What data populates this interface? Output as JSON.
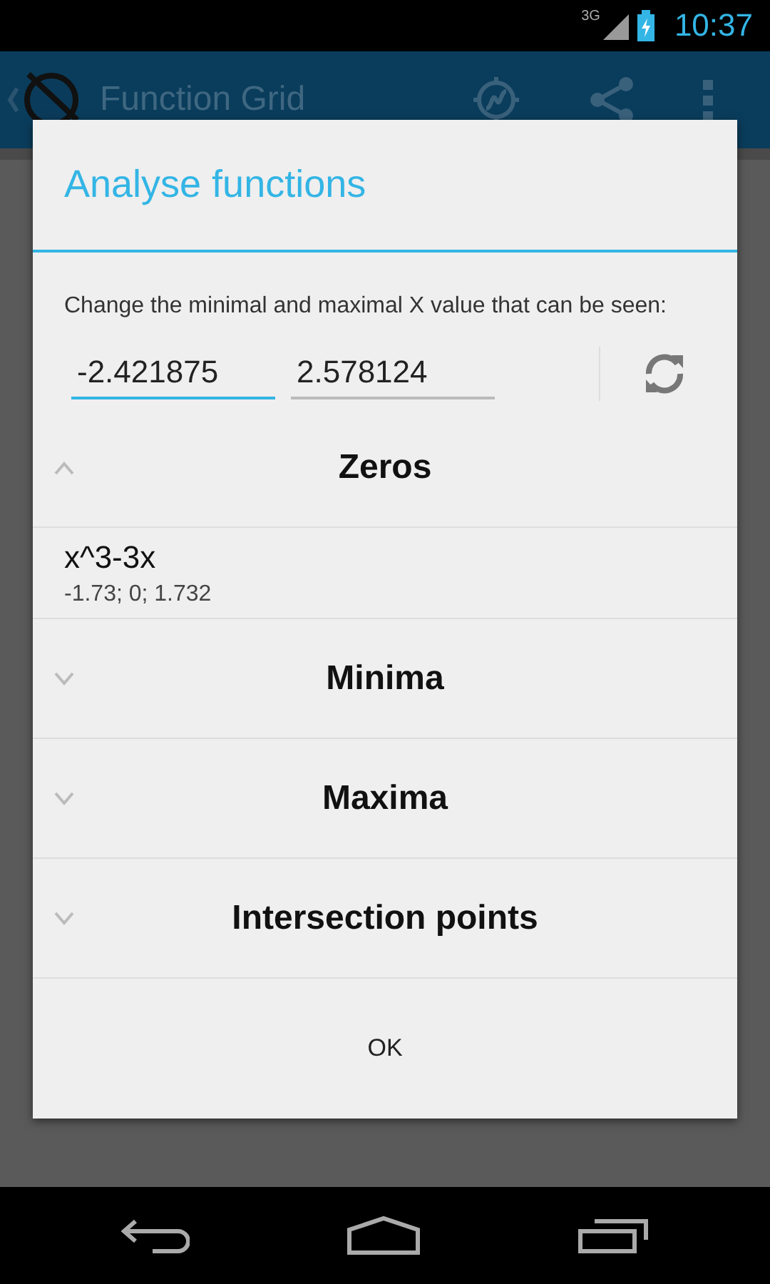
{
  "status_bar": {
    "network": "3G",
    "time": "10:37"
  },
  "app_bar": {
    "title": "Function Grid"
  },
  "dialog": {
    "title": "Analyse functions",
    "description": "Change the minimal and maximal X value that can be seen:",
    "fields": [
      {
        "value": "-2.421875",
        "focused": true
      },
      {
        "value": "2.578124",
        "focused": false
      }
    ],
    "sections": [
      {
        "title": "Zeros",
        "expanded": true,
        "items": [
          {
            "function": "x^3-3x",
            "values": "-1.73; 0; 1.732"
          }
        ]
      },
      {
        "title": "Minima",
        "expanded": false
      },
      {
        "title": "Maxima",
        "expanded": false
      },
      {
        "title": "Intersection points",
        "expanded": false
      }
    ],
    "button": "OK"
  }
}
